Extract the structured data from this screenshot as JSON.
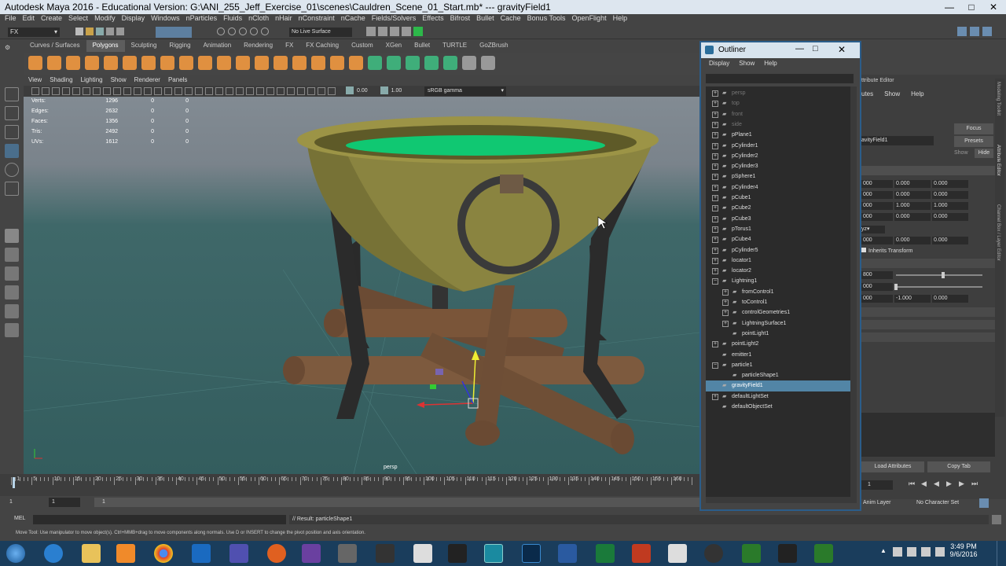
{
  "window": {
    "title": "Autodesk Maya 2016 - Educational Version: G:\\ANI_255_Jeff_Exercise_01\\scenes\\Cauldren_Scene_01_Start.mb* --- gravityField1"
  },
  "menu": [
    "File",
    "Edit",
    "Create",
    "Select",
    "Modify",
    "Display",
    "Windows",
    "nParticles",
    "Fluids",
    "nCloth",
    "nHair",
    "nConstraint",
    "nCache",
    "Fields/Solvers",
    "Effects",
    "Bifrost",
    "Bullet",
    "Cache",
    "Bonus Tools",
    "OpenFlight",
    "Help"
  ],
  "status": {
    "menuset": "FX",
    "live_surface": "No Live Surface"
  },
  "shelf": {
    "tabs": [
      "Curves / Surfaces",
      "Polygons",
      "Sculpting",
      "Rigging",
      "Animation",
      "Rendering",
      "FX",
      "FX Caching",
      "Custom",
      "XGen",
      "Bullet",
      "TURTLE",
      "GoZBrush"
    ]
  },
  "viewport": {
    "menu": [
      "View",
      "Shading",
      "Lighting",
      "Show",
      "Renderer",
      "Panels"
    ],
    "gamma": "sRGB gamma",
    "val1": "0.00",
    "val2": "1.00",
    "camera": "persp",
    "hud": [
      {
        "label": "Verts:",
        "v": "1296",
        "a": "0",
        "b": "0"
      },
      {
        "label": "Edges:",
        "v": "2632",
        "a": "0",
        "b": "0"
      },
      {
        "label": "Faces:",
        "v": "1356",
        "a": "0",
        "b": "0"
      },
      {
        "label": "Tris:",
        "v": "2492",
        "a": "0",
        "b": "0"
      },
      {
        "label": "UVs:",
        "v": "1612",
        "a": "0",
        "b": "0"
      }
    ]
  },
  "timeline": {
    "ticks": [
      "1",
      "5",
      "10",
      "15",
      "20",
      "25",
      "30",
      "35",
      "40",
      "45",
      "50",
      "55",
      "60",
      "65",
      "70",
      "75",
      "80",
      "85",
      "90",
      "95",
      "100",
      "105",
      "110",
      "115",
      "120",
      "125",
      "130",
      "135",
      "140",
      "145",
      "150",
      "155",
      "160"
    ],
    "start": "1",
    "current": "1",
    "range_start": "1"
  },
  "mel": {
    "label": "MEL",
    "result": "// Result: particleShape1"
  },
  "help_line": "Move Tool: Use manipulator to move object(s). Ctrl+MMB+drag to move components along normals. Use D or INSERT to change the pivot position and axis orientation.",
  "outliner": {
    "title": "Outliner",
    "menu": [
      "Display",
      "Show",
      "Help"
    ],
    "nodes": [
      {
        "name": "persp",
        "indent": 0,
        "exp": "+",
        "dim": true
      },
      {
        "name": "top",
        "indent": 0,
        "exp": "+",
        "dim": true
      },
      {
        "name": "front",
        "indent": 0,
        "exp": "+",
        "dim": true
      },
      {
        "name": "side",
        "indent": 0,
        "exp": "+",
        "dim": true
      },
      {
        "name": "pPlane1",
        "indent": 0,
        "exp": "+"
      },
      {
        "name": "pCylinder1",
        "indent": 0,
        "exp": "+"
      },
      {
        "name": "pCylinder2",
        "indent": 0,
        "exp": "+"
      },
      {
        "name": "pCylinder3",
        "indent": 0,
        "exp": "+"
      },
      {
        "name": "pSphere1",
        "indent": 0,
        "exp": "+"
      },
      {
        "name": "pCylinder4",
        "indent": 0,
        "exp": "+"
      },
      {
        "name": "pCube1",
        "indent": 0,
        "exp": "+"
      },
      {
        "name": "pCube2",
        "indent": 0,
        "exp": "+"
      },
      {
        "name": "pCube3",
        "indent": 0,
        "exp": "+"
      },
      {
        "name": "pTorus1",
        "indent": 0,
        "exp": "+"
      },
      {
        "name": "pCube4",
        "indent": 0,
        "exp": "+"
      },
      {
        "name": "pCylinder5",
        "indent": 0,
        "exp": "+"
      },
      {
        "name": "locator1",
        "indent": 0,
        "exp": "+"
      },
      {
        "name": "locator2",
        "indent": 0,
        "exp": "+"
      },
      {
        "name": "Lightning1",
        "indent": 0,
        "exp": "-"
      },
      {
        "name": "fromControl1",
        "indent": 1,
        "exp": "+"
      },
      {
        "name": "toControl1",
        "indent": 1,
        "exp": "+"
      },
      {
        "name": "controlGeometries1",
        "indent": 1,
        "exp": "+"
      },
      {
        "name": "LightningSurface1",
        "indent": 1,
        "exp": "+"
      },
      {
        "name": "pointLight1",
        "indent": 1,
        "exp": ""
      },
      {
        "name": "pointLight2",
        "indent": 0,
        "exp": "+"
      },
      {
        "name": "emitter1",
        "indent": 0,
        "exp": ""
      },
      {
        "name": "particle1",
        "indent": 0,
        "exp": "-"
      },
      {
        "name": "particleShape1",
        "indent": 1,
        "exp": ""
      },
      {
        "name": "gravityField1",
        "indent": 0,
        "exp": "",
        "sel": true
      },
      {
        "name": "defaultLightSet",
        "indent": 0,
        "exp": "+"
      },
      {
        "name": "defaultObjectSet",
        "indent": 0,
        "exp": ""
      }
    ]
  },
  "attr_editor": {
    "title": "ttribute Editor",
    "menu": [
      "utes",
      "Show",
      "Help"
    ],
    "node": "avityField1",
    "focus": "Focus",
    "presets": "Presets",
    "show": "Show",
    "hide": "Hide",
    "rows": [
      [
        "000",
        "0.000",
        "0.000"
      ],
      [
        "000",
        "0.000",
        "0.000"
      ],
      [
        "000",
        "1.000",
        "1.000"
      ],
      [
        "000",
        "0.000",
        "0.000"
      ]
    ],
    "row5": [
      "000",
      "0.000",
      "0.000"
    ],
    "inherits": "Inherits Transform",
    "v800": "800",
    "v000": "000",
    "row8": [
      "000",
      "-1.000",
      "0.000"
    ],
    "load": "Load Attributes",
    "copy": "Copy Tab",
    "anim_layer": "Anim Layer",
    "char_set": "No Character Set",
    "frame": "1"
  },
  "side_tabs": [
    "Modeling Toolkit",
    "Attribute Editor",
    "Channel Box / Layer Editor"
  ],
  "taskbar": {
    "time": "3:49 PM",
    "date": "9/6/2016"
  }
}
